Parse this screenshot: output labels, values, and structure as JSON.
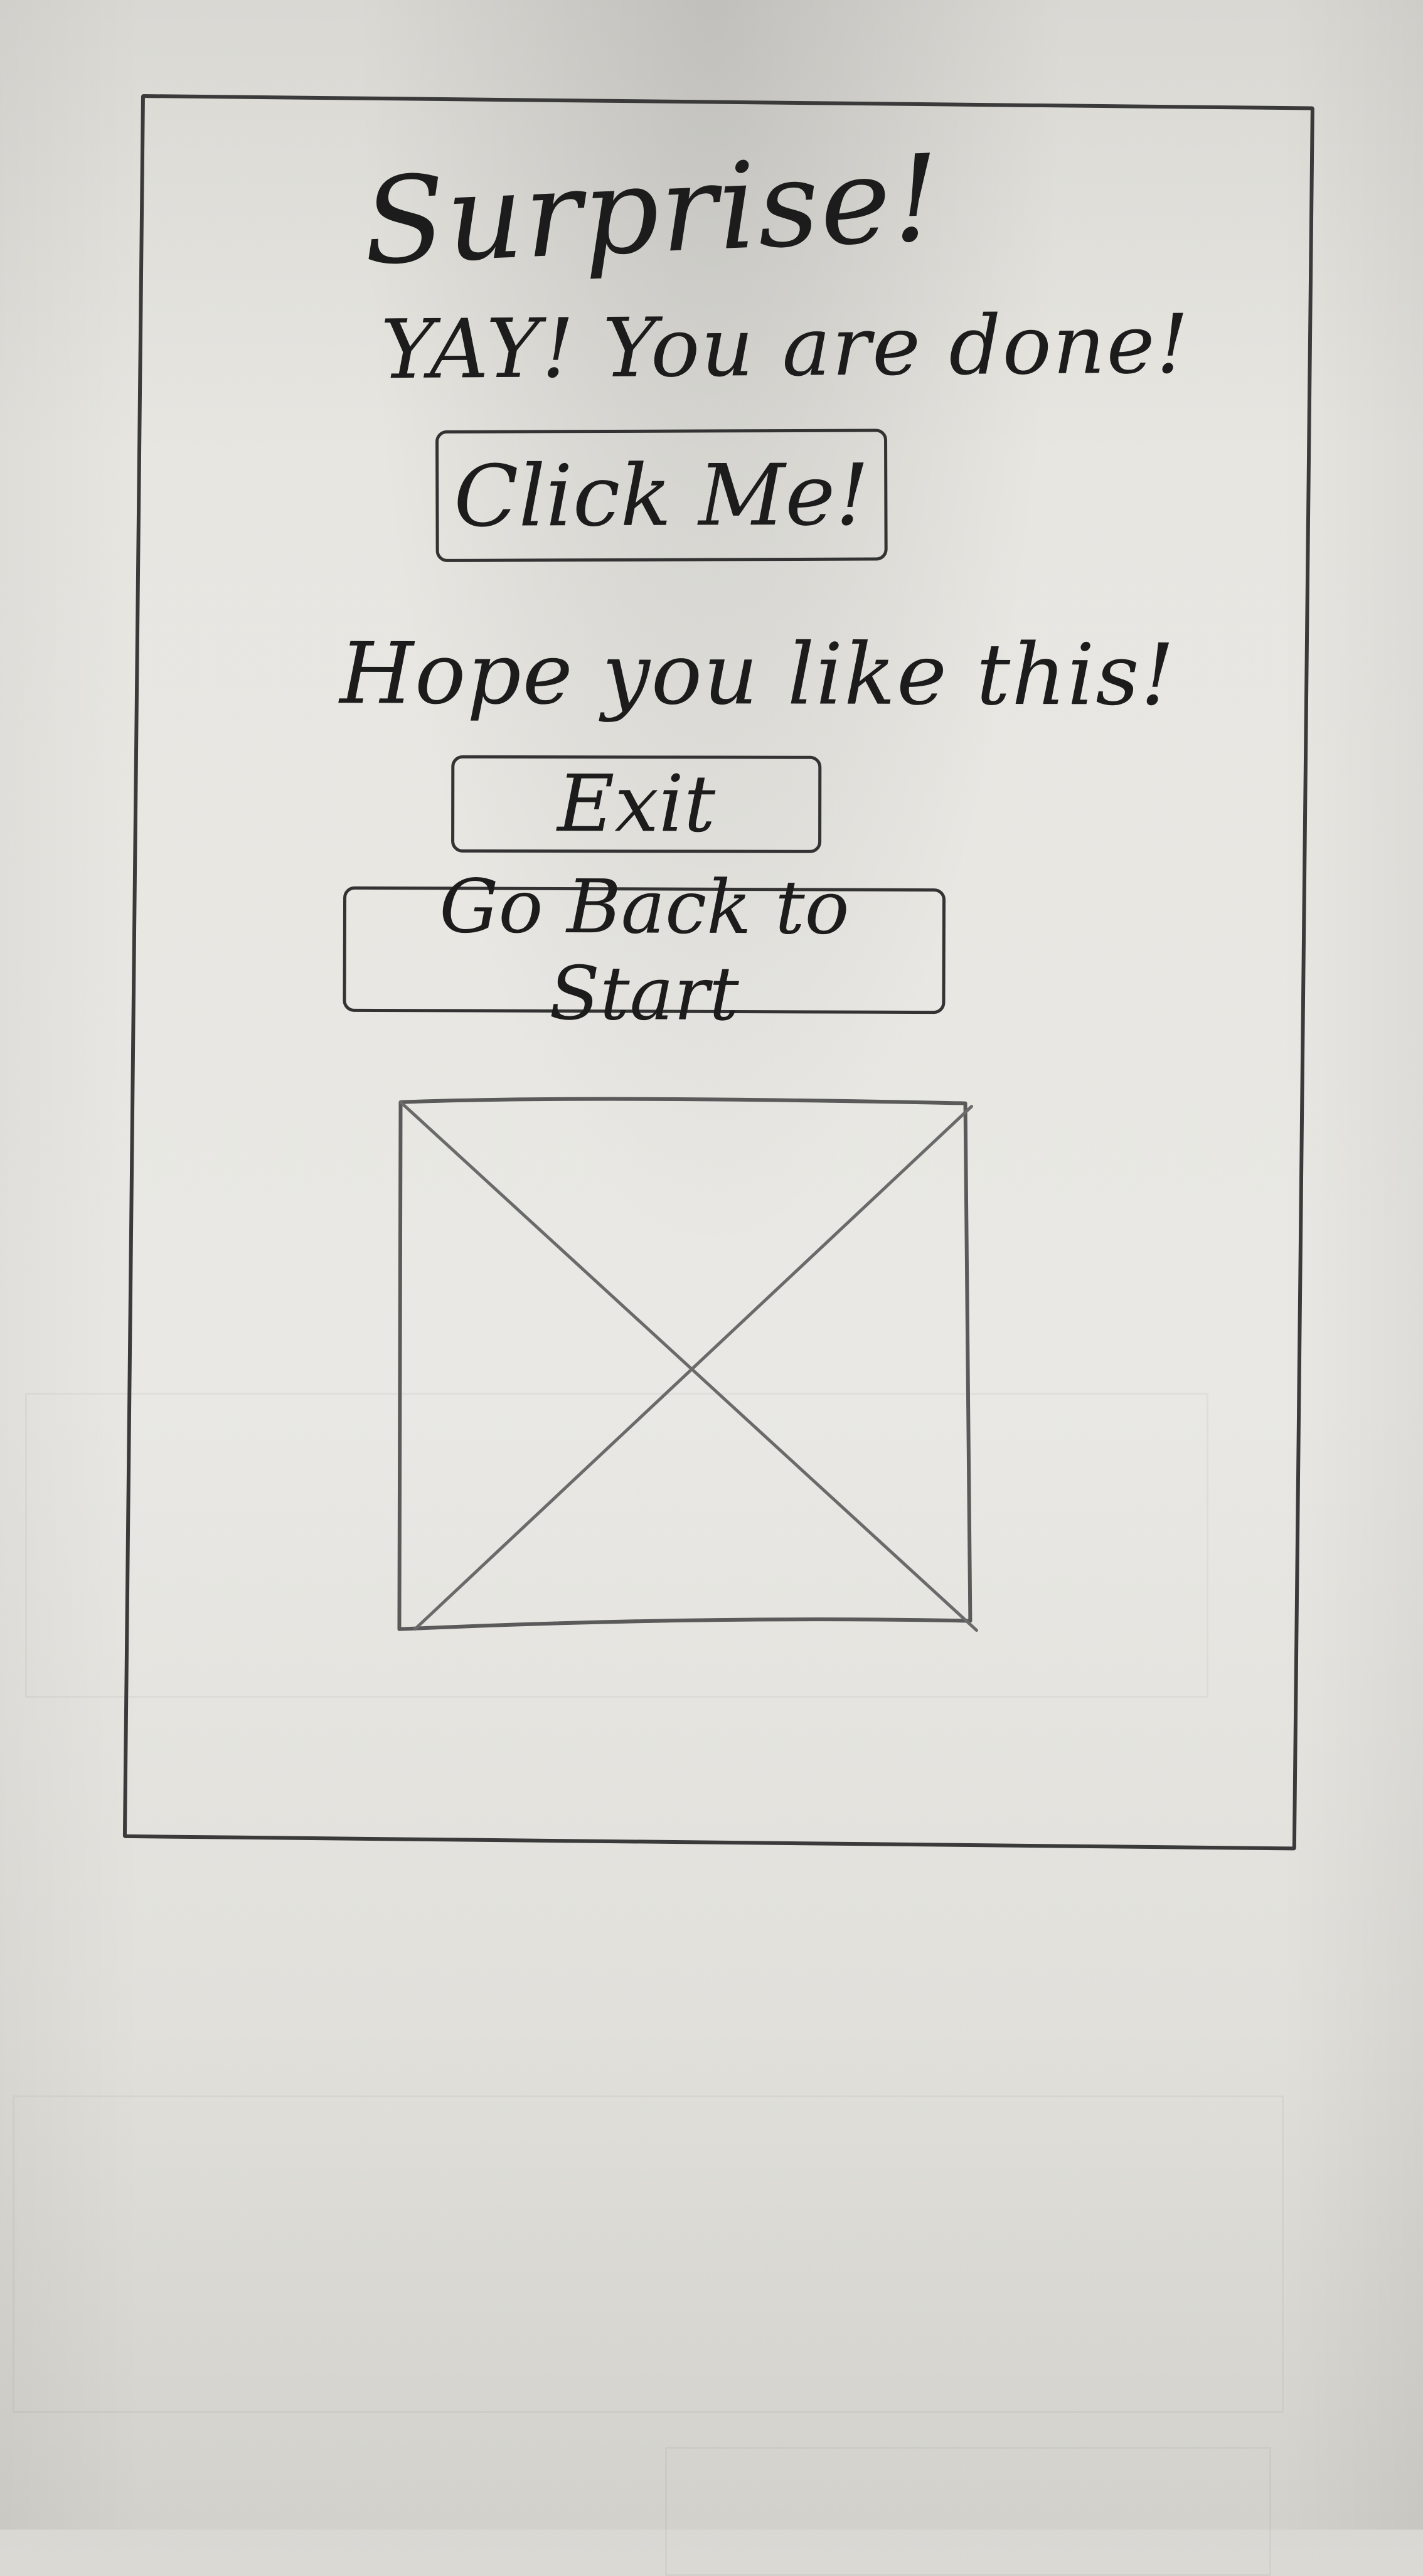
{
  "screen": {
    "title": "Surprise!",
    "subtitle": "YAY! You are done!",
    "primary_button": "Click Me!",
    "message": "Hope you like this!",
    "exit_button": "Exit",
    "back_button": "Go Back to Start"
  },
  "image_placeholder": {
    "icon": "image-placeholder-icon"
  }
}
